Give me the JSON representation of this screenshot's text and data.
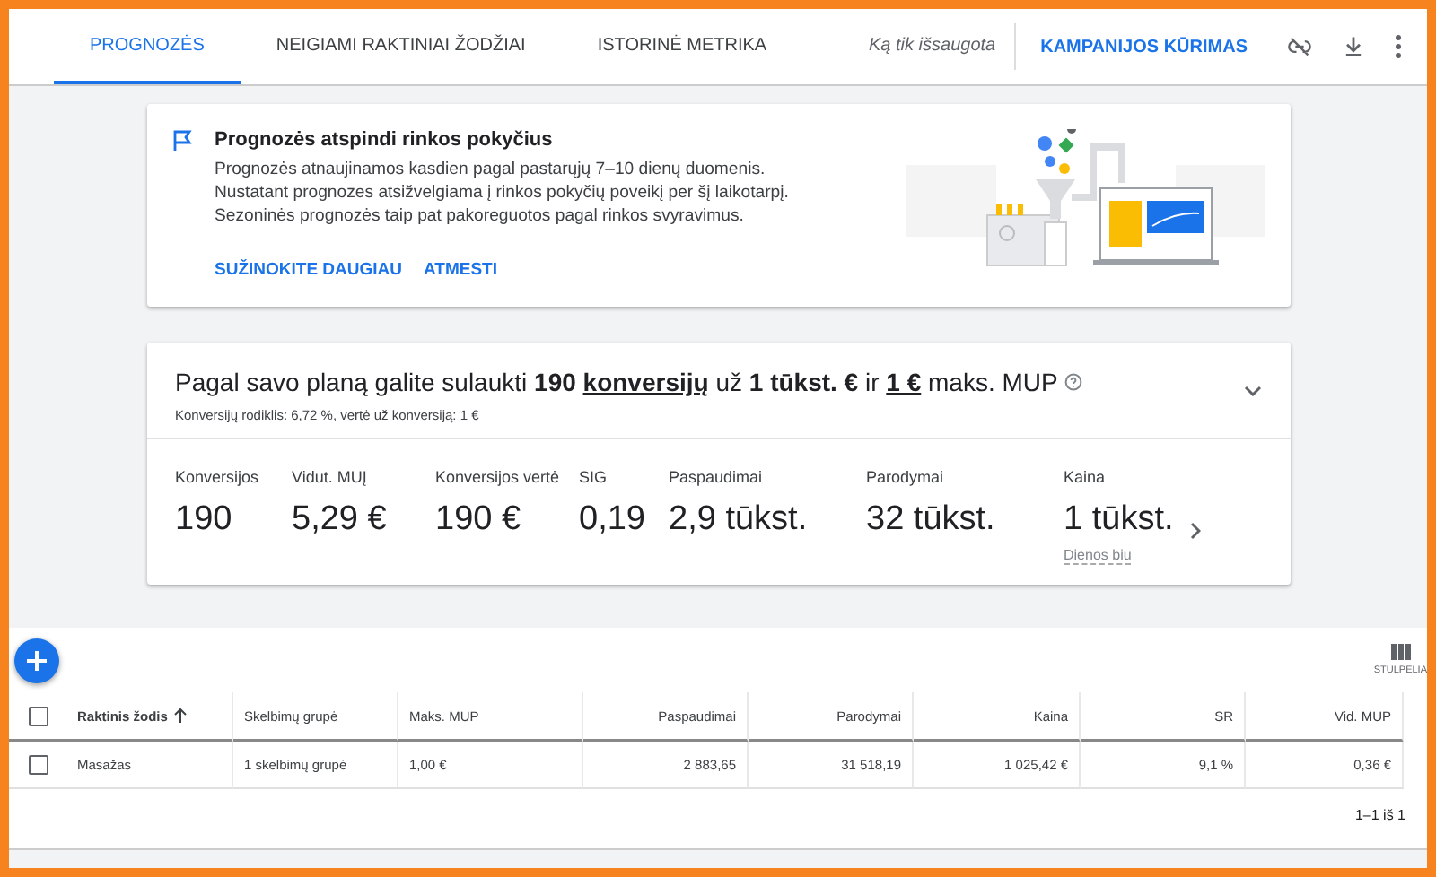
{
  "tabs": [
    {
      "label": "PROGNOZĖS",
      "selected": true
    },
    {
      "label": "NEIGIAMI RAKTINIAI ŽODŽIAI",
      "selected": false
    },
    {
      "label": "ISTORINĖ METRIKA",
      "selected": false
    }
  ],
  "save_status": "Ką tik išsaugota",
  "header_action": "KAMPANIJOS KŪRIMAS",
  "notice": {
    "title": "Prognozės atspindi rinkos pokyčius",
    "body": "Prognozės atnaujinamos kasdien pagal pastarųjų 7–10 dienų duomenis. Nustatant prognozes atsižvelgiama į rinkos pokyčių poveikį per šį laikotarpį. Sezoninės prognozės taip pat pakoreguotos pagal rinkos svyravimus.",
    "actions": [
      "SUŽINOKITE DAUGIAU",
      "ATMESTI"
    ]
  },
  "plan": {
    "headline": [
      {
        "text": "Pagal savo planą galite sulaukti ",
        "bold": false,
        "underline": false
      },
      {
        "text": "190 ",
        "bold": true,
        "underline": false
      },
      {
        "text": "konversijų",
        "bold": true,
        "underline": true
      },
      {
        "text": " už ",
        "bold": false,
        "underline": false
      },
      {
        "text": "1 tūkst. €",
        "bold": true,
        "underline": false
      },
      {
        "text": " ir ",
        "bold": false,
        "underline": false
      },
      {
        "text": "1 €",
        "bold": true,
        "underline": true
      },
      {
        "text": " maks. MUP",
        "bold": false,
        "underline": false
      }
    ],
    "subline": "Konversijų rodiklis: 6,72 %, vertė už konversiją: 1 €",
    "metrics": [
      {
        "label": "Konversijos",
        "value": "190"
      },
      {
        "label": "Vidut. MUĮ",
        "value": "5,29 €"
      },
      {
        "label": "Konversijos vertė",
        "value": "190 €"
      },
      {
        "label": "SIG",
        "value": "0,19"
      },
      {
        "label": "Paspaudimai",
        "value": "2,9 tūkst."
      },
      {
        "label": "Parodymai",
        "value": "32 tūkst."
      },
      {
        "label": "Kaina",
        "value": "1 tūkst.",
        "note": "Dienos biu"
      }
    ]
  },
  "table": {
    "columns_button": "STULPELIA",
    "columns": [
      {
        "label": "Raktinis žodis",
        "sorted": true
      },
      {
        "label": "Skelbimų grupė",
        "sorted": false
      },
      {
        "label": "Maks. MUP",
        "sorted": false
      },
      {
        "label": "Paspaudimai",
        "sorted": false
      },
      {
        "label": "Parodymai",
        "sorted": false
      },
      {
        "label": "Kaina",
        "sorted": false
      },
      {
        "label": "SR",
        "sorted": false
      },
      {
        "label": "Vid. MUP",
        "sorted": false
      }
    ],
    "header_checked": false,
    "rows": [
      {
        "checked": false,
        "cells": [
          "Masažas",
          "1 skelbimų grupė",
          "1,00 €",
          "2 883,65",
          "31 518,19",
          "1 025,42 €",
          "9,1 %",
          "0,36 €"
        ]
      }
    ],
    "pagination": "1–1 iš 1"
  }
}
